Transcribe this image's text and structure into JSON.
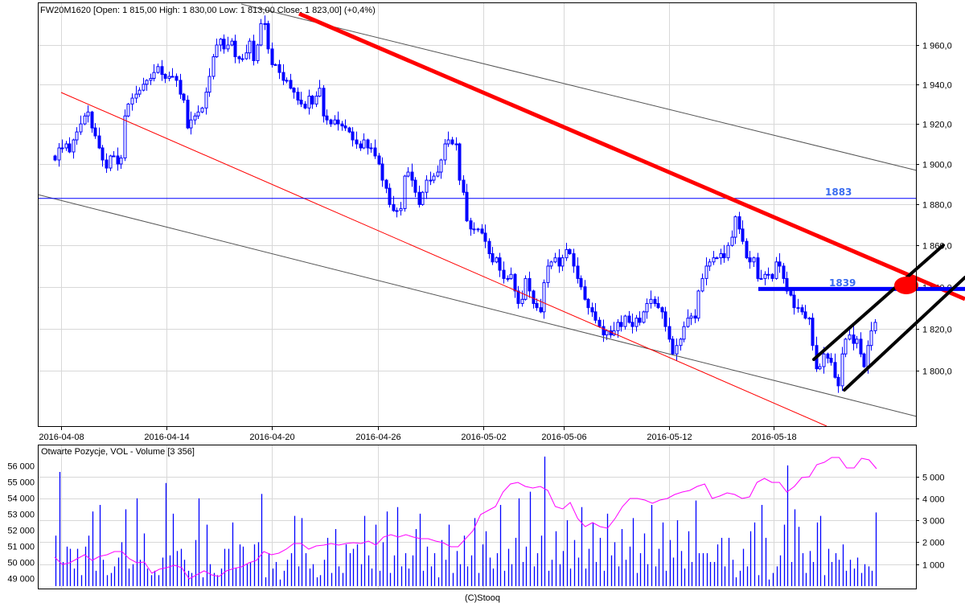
{
  "chart_data": [
    {
      "type": "candlestick",
      "title": "FW20M1620 [Open: 1 815,00  High: 1 830,00  Low: 1 813,00  Close: 1 823,00] (+0,4%)",
      "scale": "log",
      "ylim": [
        1774,
        1982
      ],
      "y_ticks": [
        "1 960,0",
        "1 940,0",
        "1 920,0",
        "1 900,0",
        "1 880,0",
        "1 860,0",
        "1 840,0",
        "1 820,0",
        "1 800,0"
      ],
      "y_tick_values": [
        1960,
        1940,
        1920,
        1900,
        1880,
        1860,
        1840,
        1820,
        1800
      ],
      "x_ticks": [
        "2016-04-08",
        "2016-04-14",
        "2016-04-20",
        "2016-04-26",
        "2016-05-02",
        "2016-05-06",
        "2016-05-12",
        "2016-05-18"
      ],
      "grid": true,
      "color": "#0000ff",
      "close": [
        1902,
        1908,
        1908,
        1910,
        1906,
        1912,
        1916,
        1920,
        1924,
        1926,
        1918,
        1914,
        1908,
        1902,
        1898,
        1904,
        1904,
        1900,
        1903,
        1924,
        1930,
        1933,
        1935,
        1937,
        1940,
        1942,
        1943,
        1946,
        1949,
        1945,
        1943,
        1944,
        1944,
        1942,
        1935,
        1932,
        1918,
        1922,
        1924,
        1926,
        1928,
        1936,
        1944,
        1954,
        1960,
        1963,
        1958,
        1960,
        1962,
        1954,
        1953,
        1953,
        1956,
        1962,
        1952,
        1960,
        1971,
        1971,
        1958,
        1950,
        1950,
        1946,
        1942,
        1942,
        1938,
        1936,
        1932,
        1930,
        1928,
        1934,
        1930,
        1934,
        1938,
        1924,
        1922,
        1920,
        1922,
        1920,
        1919,
        1918,
        1916,
        1912,
        1910,
        1908,
        1912,
        1908,
        1908,
        1904,
        1900,
        1892,
        1888,
        1880,
        1877,
        1877,
        1878,
        1894,
        1896,
        1892,
        1886,
        1880,
        1886,
        1892,
        1892,
        1894,
        1896,
        1902,
        1910,
        1912,
        1910,
        1910,
        1892,
        1886,
        1872,
        1868,
        1868,
        1868,
        1866,
        1862,
        1856,
        1852,
        1854,
        1848,
        1844,
        1844,
        1846,
        1838,
        1832,
        1834,
        1844,
        1838,
        1832,
        1830,
        1828,
        1842,
        1850,
        1852,
        1854,
        1850,
        1854,
        1858,
        1856,
        1850,
        1844,
        1840,
        1834,
        1830,
        1828,
        1824,
        1821,
        1817,
        1819,
        1817,
        1819,
        1823,
        1821,
        1826,
        1823,
        1821,
        1825,
        1823,
        1828,
        1832,
        1834,
        1832,
        1830,
        1828,
        1821,
        1815,
        1808,
        1812,
        1815,
        1821,
        1825,
        1826,
        1825,
        1838,
        1844,
        1850,
        1852,
        1854,
        1854,
        1856,
        1854,
        1860,
        1864,
        1874,
        1868,
        1862,
        1854,
        1852,
        1854,
        1844,
        1844,
        1846,
        1846,
        1844,
        1852,
        1850,
        1844,
        1838,
        1836,
        1830,
        1830,
        1828,
        1825,
        1825,
        1812,
        1801,
        1802,
        1808,
        1806,
        1804,
        1797,
        1793,
        1808,
        1815,
        1817,
        1813,
        1815,
        1808,
        1802,
        1812,
        1819,
        1823
      ],
      "levels": [
        {
          "value": 1883,
          "label": "1883",
          "color": "#0000ff"
        },
        {
          "value": 1839,
          "label": "1839",
          "color": "#0000ff"
        }
      ],
      "annotations": [
        "red downtrend line",
        "grey channel lines",
        "black rising channel",
        "red circle at trendline/1839 intersection"
      ]
    },
    {
      "type": "bar+line",
      "title": "Otwarte Pozycje, VOL - Volume [3 356]",
      "left_axis": {
        "name": "Otwarte Pozycje",
        "ticks": [
          "56 000",
          "55 000",
          "54 000",
          "53 000",
          "52 000",
          "51 000",
          "50 000",
          "49 000"
        ],
        "tick_values": [
          56000,
          55000,
          54000,
          53000,
          52000,
          51000,
          50000,
          49000
        ],
        "color": "#ff00ff"
      },
      "right_axis": {
        "name": "Volume",
        "ticks": [
          "5 000",
          "4 000",
          "3 000",
          "2 000",
          "1 000"
        ],
        "tick_values": [
          5000,
          4000,
          3000,
          2000,
          1000
        ],
        "color": "#0000ff"
      },
      "open_interest": [
        50300,
        49850,
        49950,
        50200,
        50450,
        50100,
        50350,
        50450,
        50650,
        50650,
        50200,
        49950,
        50000,
        49300,
        49550,
        49650,
        49800,
        49650,
        48950,
        49200,
        49450,
        49200,
        49100,
        49450,
        49600,
        49700,
        49950,
        50100,
        50650,
        50450,
        50550,
        50800,
        51150,
        51150,
        50800,
        51000,
        51050,
        51150,
        51050,
        51150,
        51200,
        51150,
        51300,
        51050,
        51550,
        51700,
        51550,
        51700,
        51550,
        51450,
        51450,
        51300,
        51200,
        50950,
        50950,
        51450,
        51950,
        52950,
        53200,
        53450,
        54350,
        54850,
        54950,
        54700,
        54600,
        54700,
        54450,
        53450,
        53300,
        53700,
        52700,
        52200,
        52450,
        52200,
        52100,
        52700,
        53450,
        53950,
        53950,
        53850,
        53650,
        53850,
        53950,
        54200,
        54350,
        54450,
        54700,
        54850,
        53950,
        54100,
        54300,
        54200,
        53950,
        54050,
        54950,
        55200,
        54950,
        54950,
        54350,
        54700,
        55250,
        55300,
        56050,
        56200,
        56500,
        56500,
        55850,
        55850,
        56450,
        56350,
        55800
      ],
      "volume": [
        2300,
        5200,
        1100,
        1800,
        1700,
        800,
        1700,
        500,
        1800,
        2300,
        3400,
        700,
        3700,
        1200,
        500,
        600,
        900,
        1300,
        2000,
        3500,
        800,
        1000,
        4000,
        1200,
        2400,
        800,
        500,
        700,
        500,
        1300,
        4700,
        1400,
        3300,
        1600,
        1700,
        1200,
        700,
        600,
        2100,
        4000,
        400,
        2800,
        1000,
        600,
        500,
        800,
        1700,
        1700,
        2900,
        800,
        1900,
        1800,
        1000,
        1100,
        1900,
        2000,
        4200,
        400,
        1500,
        800,
        1100,
        300,
        700,
        1200,
        1500,
        3200,
        900,
        3100,
        1500,
        800,
        1000,
        400,
        500,
        1200,
        2200,
        600,
        2600,
        900,
        600,
        1900,
        1500,
        1700,
        1900,
        1000,
        3200,
        1400,
        800,
        2800,
        700,
        2000,
        3400,
        600,
        1400,
        3600,
        900,
        1500,
        800,
        1400,
        2600,
        3300,
        700,
        1800,
        900,
        1500,
        400,
        2100,
        1200,
        2800,
        600,
        1600,
        1000,
        2300,
        900,
        1400,
        3100,
        600,
        1900,
        2500,
        1300,
        800,
        1500,
        3700,
        700,
        1700,
        1000,
        2200,
        4000,
        1100,
        1800,
        4300,
        900,
        1500,
        2300,
        5900,
        700,
        1200,
        2500,
        1000,
        1600,
        3000,
        800,
        2100,
        1300,
        3600,
        800,
        1700,
        2900,
        1100,
        2200,
        700,
        3300,
        1400,
        2000,
        900,
        2600,
        1200,
        1800,
        3100,
        600,
        1500,
        2400,
        1000,
        3700,
        900,
        1700,
        2900,
        700,
        2100,
        1300,
        3000,
        1600,
        800,
        2500,
        1100,
        3900,
        1500,
        1500,
        1500,
        1100,
        1100,
        1900,
        2200,
        900,
        2200,
        1200,
        400,
        700,
        1700,
        900,
        2500,
        2900,
        500,
        3700,
        2200,
        300,
        600,
        900,
        1400,
        2800,
        5500,
        1100,
        3500,
        2700,
        1500,
        600,
        1600,
        1100,
        2900,
        3200,
        500,
        1700,
        1100,
        1500,
        1200,
        1900,
        700,
        1200,
        800,
        1300,
        600,
        1000,
        900,
        700,
        3356
      ]
    }
  ],
  "footer": "(C)Stooq"
}
